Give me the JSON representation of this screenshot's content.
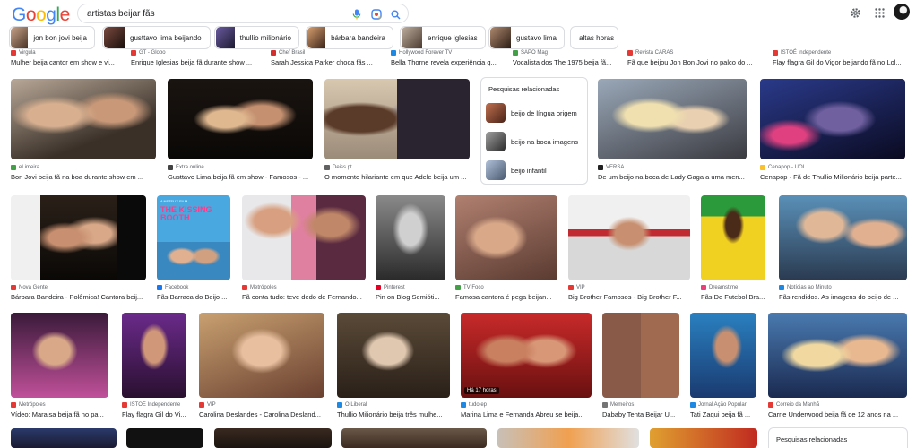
{
  "header": {
    "logo_letters": [
      {
        "ch": "G",
        "color": "#4285F4"
      },
      {
        "ch": "o",
        "color": "#EA4335"
      },
      {
        "ch": "o",
        "color": "#FBBC05"
      },
      {
        "ch": "g",
        "color": "#4285F4"
      },
      {
        "ch": "l",
        "color": "#34A853"
      },
      {
        "ch": "e",
        "color": "#EA4335"
      }
    ],
    "search_value": "artistas beijar fãs"
  },
  "chips": [
    {
      "label": "jon bon jovi beija",
      "color": "#8a6a5c"
    },
    {
      "label": "gusttavo lima beijando",
      "color": "#5a3a36"
    },
    {
      "label": "thullio milionário",
      "color": "#3c3a5a"
    },
    {
      "label": "bárbara bandeira",
      "color": "#6a4a38"
    },
    {
      "label": "enrique iglesias",
      "color": "#7a6a58"
    },
    {
      "label": "gustavo lima",
      "color": "#6a5040"
    },
    {
      "label": "altas horas",
      "color": null
    }
  ],
  "row0": [
    {
      "source": "Virgula",
      "title": "Mulher beija cantor em show e vi...",
      "fav": "#e53935"
    },
    {
      "source": "GT - Globo",
      "title": "Enrique Iglesias beija fã durante show ...",
      "fav": "#e53935"
    },
    {
      "source": "Chef Brasil",
      "title": "Sarah Jessica Parker choca fãs ...",
      "fav": "#d32f2f"
    },
    {
      "source": "Hollywood Forever TV",
      "title": "Bella Thorne revela experiência q...",
      "fav": "#1e88e5"
    },
    {
      "source": "SAPO Mag",
      "title": "Vocalista dos The 1975 beija fã...",
      "fav": "#43a047"
    },
    {
      "source": "Revista CARAS",
      "title": "Fã que beijou Jon Bon Jovi no palco do ...",
      "fav": "#e53935"
    },
    {
      "source": "ISTOÉ Independente",
      "title": "Flay flagra Gil do Vigor beijando fã no Lol...",
      "fav": "#e53935"
    }
  ],
  "row1": [
    {
      "source": "eLimeira",
      "title": "Bon Jovi beija fã na boa durante show em ...",
      "fav": "#43a047"
    },
    {
      "source": "Extra online",
      "title": "Gusttavo Lima beija fã em show - Famosos - ...",
      "fav": "#424242"
    },
    {
      "source": "Deiss.pt",
      "title": "O momento hilariante em que Adele beija um ...",
      "fav": "#616161"
    },
    {
      "source": "VERSA",
      "title": "De um beijo na boca de Lady Gaga a uma men...",
      "fav": "#212121"
    },
    {
      "source": "Cenapop - UOL",
      "title": "Cenapop · Fã de Thullio Milionário beija parte...",
      "fav": "#fbc02d"
    }
  ],
  "related": {
    "title": "Pesquisas relacionadas",
    "items": [
      {
        "label": "beijo de língua origem",
        "color": "#8a4a3a"
      },
      {
        "label": "beijo na boca imagens",
        "color": "#6a6a6a"
      },
      {
        "label": "beijo infantil",
        "color": "#7a8aa0"
      }
    ]
  },
  "row2": [
    {
      "source": "Nova Gente",
      "title": "Bárbara Bandeira - Polêmica! Cantora beij...",
      "fav": "#e53935"
    },
    {
      "source": "Facebook",
      "title": "Fãs Barraca do Beijo ...",
      "fav": "#1877f2"
    },
    {
      "source": "Metrópoles",
      "title": "Fã conta tudo: teve dedo de Fernando...",
      "fav": "#e53935"
    },
    {
      "source": "Pinterest",
      "title": "Pin on Blog Semióti...",
      "fav": "#e60023"
    },
    {
      "source": "TV Foco",
      "title": "Famosa cantora é pega beijan...",
      "fav": "#43a047"
    },
    {
      "source": "VIP",
      "title": "Big Brother Famosos - Big Brother F...",
      "fav": "#e53935"
    },
    {
      "source": "Dreamstime",
      "title": "Fãs De Futebol Bra...",
      "fav": "#ec407a"
    },
    {
      "source": "Notícias ao Minuto",
      "title": "Fãs rendidos. As imagens do beijo de ...",
      "fav": "#1e88e5"
    }
  ],
  "row2_poster": {
    "top": "A NETFLIX FILM",
    "title": "THE KISSING BOOTH"
  },
  "row3": [
    {
      "source": "Metrópoles",
      "title": "Vídeo: Maraisa beija fã no pa...",
      "fav": "#e53935"
    },
    {
      "source": "ISTOÉ Independente",
      "title": "Flay flagra Gil do Vi...",
      "fav": "#e53935"
    },
    {
      "source": "VIP",
      "title": "Carolina Deslandes - Carolina Desland...",
      "fav": "#e53935"
    },
    {
      "source": "O Liberal",
      "title": "Thullio Milionário beija três mulhe...",
      "fav": "#1e88e5"
    },
    {
      "source": "tudo ep",
      "title": "Marina Lima e Fernanda Abreu se beija...",
      "fav": "#1e88e5"
    },
    {
      "source": "Memeiros",
      "title": "Dababy Tenta Beijar U...",
      "fav": "#757575"
    },
    {
      "source": "Jornal Ação Popular",
      "title": "Tati Zaqui beija fã ...",
      "fav": "#1e88e5"
    },
    {
      "source": "Correio da Manhã",
      "title": "Carrie Underwood beija fã de 12 anos na ...",
      "fav": "#e53935"
    }
  ],
  "row3_badge": "Há 17 horas",
  "related2": {
    "title": "Pesquisas relacionadas"
  }
}
